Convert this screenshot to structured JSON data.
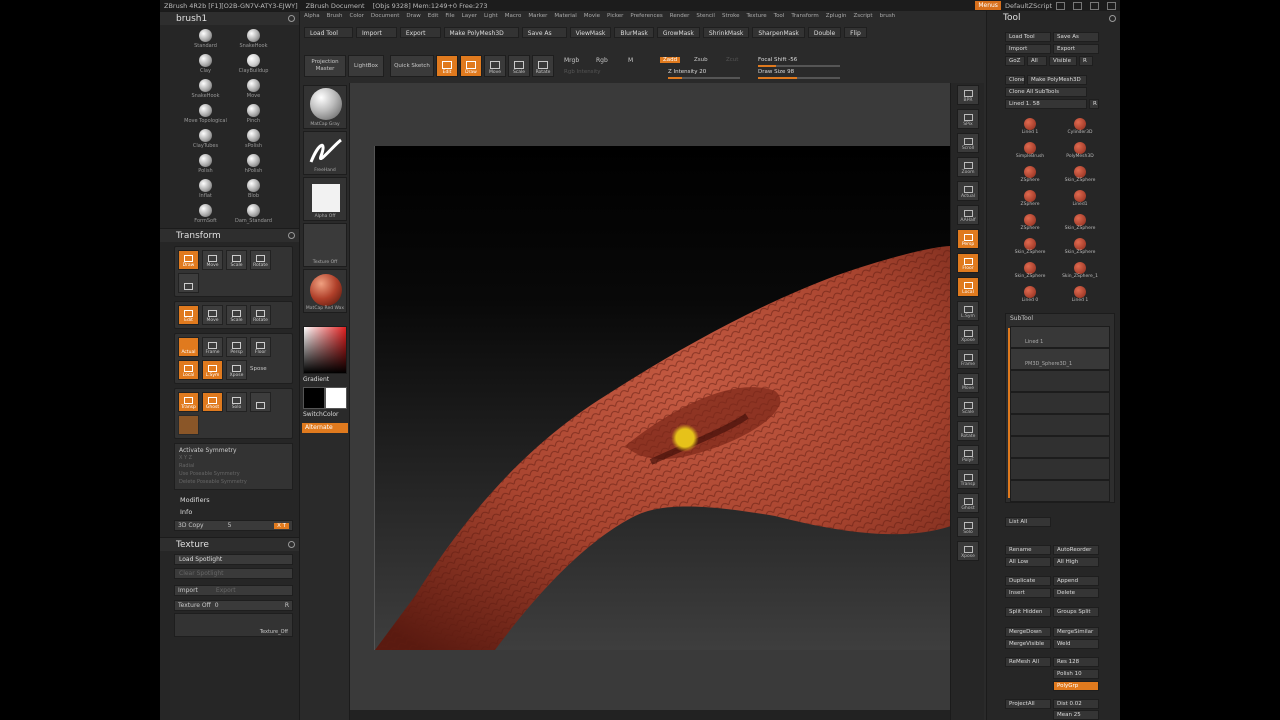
{
  "titlebar": {
    "app": "ZBrush 4R2b [F1][O2B-GN7V-ATY3-EJWY]",
    "doc": "ZBrush Document",
    "stats": "[Objs 9328] Mem:1249+0 Free:273",
    "menus_label": "Menus",
    "script": "DefaultZScript"
  },
  "menubar": [
    "Alpha",
    "Brush",
    "Color",
    "Document",
    "Draw",
    "Edit",
    "File",
    "Layer",
    "Light",
    "Macro",
    "Marker",
    "Material",
    "Movie",
    "Picker",
    "Preferences",
    "Render",
    "Stencil",
    "Stroke",
    "Texture",
    "Tool",
    "Transform",
    "Zplugin",
    "Zscript",
    "brush"
  ],
  "top_buttons": [
    "Load Tool",
    "Import",
    "Export",
    "Make PolyMesh3D",
    "Save As",
    "ViewMask",
    "BlurMask",
    "GrowMask",
    "ShrinkMask",
    "SharpenMask",
    "Double",
    "Flip"
  ],
  "projection": "Projection Master",
  "lightbox": "LightBox",
  "quick_sketch": "Quick Sketch",
  "tools": [
    {
      "label": "Edit",
      "on": true
    },
    {
      "label": "Draw",
      "on": true
    },
    {
      "label": "Move",
      "on": false
    },
    {
      "label": "Scale",
      "on": false
    },
    {
      "label": "Rotate",
      "on": false
    }
  ],
  "mrgb": {
    "mrgb": "Mrgb",
    "rgb": "Rgb",
    "m": "M",
    "intensity": "Rgb Intensity"
  },
  "zadd": {
    "zadd": "Zadd",
    "zsub": "Zsub",
    "zcut": "Zcut",
    "intensity": "Z Intensity 20",
    "intensity_value": 0.2
  },
  "focal": {
    "label": "Focal Shift -56",
    "value": 0.22
  },
  "drawsize": {
    "label": "Draw Size 98",
    "value": 0.48
  },
  "left": {
    "brush_title": "brush1",
    "brushes": [
      "Standard",
      "SnakeHook",
      "Clay",
      "ClayBuildup",
      "SnakeHook",
      "Move",
      "Move Topological",
      "Pinch",
      "ClayTubes",
      "sPolish",
      "Polish",
      "hPolish",
      "Inflat",
      "Blob",
      "FormSoft",
      "Dam_Standard"
    ],
    "transform_title": "Transform",
    "transform_top": [
      "Draw",
      "Move",
      "Scale",
      "Rotate"
    ],
    "transform_mid": [
      "Edit",
      "Move",
      "Scale",
      "Rotate"
    ],
    "transform_view": [
      "Frame",
      "Persp",
      "Floor",
      "Local",
      "L.Sym",
      "Xpose",
      "Transp",
      "Ghost",
      "Solo"
    ],
    "actual": "Actual",
    "spose": "Spose",
    "activate_symmetry": "Activate Symmetry",
    "sym_rows": [
      "X Y Z",
      "Radial",
      "Use Poseable Symmetry",
      "Delete Poseable Symmetry"
    ],
    "modifiers": "Modifiers",
    "info": "Info",
    "copy_label": "3D Copy",
    "copy_value": "5",
    "copy_btn": "X T",
    "texture_title": "Texture",
    "load_spotlight": "Load Spotlight",
    "clear_spotlight": "Clear Spotlight",
    "import": "Import",
    "export": "Export",
    "texture_off": "Texture Off",
    "texture_off_value": "0",
    "r": "R",
    "texture_footer": "Texture_Off"
  },
  "shelf": {
    "material": "MatCap Gray",
    "stroke": "FreeHand",
    "alpha": "Alpha Off",
    "texture": "Texture Off",
    "material2": "MatCap Red Wax",
    "gradient": "Gradient",
    "switchcolor": "SwitchColor",
    "alternate": "Alternate"
  },
  "rightshelf": [
    "BPR",
    "SPix",
    "Scroll",
    "Zoom",
    "Actual",
    "AAHalf",
    "Persp",
    "Floor",
    "Local",
    "L.Sym",
    "Xpose",
    "Frame",
    "Move",
    "Scale",
    "Rotate",
    "PolyF",
    "Transp",
    "Ghost",
    "Solo",
    "Xpose"
  ],
  "toolpanel": {
    "title": "Tool",
    "buttons": [
      [
        "Load Tool",
        "Save As"
      ],
      [
        "Import",
        "Export"
      ],
      [
        "GoZ",
        "All",
        "Visible",
        "R"
      ],
      [
        "Clone",
        "Make PolyMesh3D"
      ],
      [
        "Clone All SubTools"
      ]
    ],
    "lined": "Lined 1. 58",
    "thumbs": [
      "Lined 1",
      "Cylinder3D",
      "SimpleBrush",
      "PolyMesh3D",
      "ZSphere",
      "Skin_ZSphere",
      "ZSphere",
      "Lined1",
      "ZSphere",
      "Skin_ZSphere",
      "Skin_ZSphere",
      "Skin_ZSphere",
      "Skin_ZSphere",
      "Skin_ZSphere_1",
      "Lined 0",
      "Lined 1"
    ],
    "subtool_title": "SubTool",
    "subtools": [
      "Lined 1",
      "PM3D_Sphere3D_1",
      "",
      "",
      "",
      "",
      "",
      ""
    ],
    "list_all": "List All",
    "rename": "Rename",
    "autoreorder": "AutoReorder",
    "all_low": "All Low",
    "all_high": "All High",
    "duplicate": "Duplicate",
    "append": "Append",
    "insert": "Insert",
    "delete": "Delete",
    "split_hidden": "Split Hidden",
    "groups_split": "Groups Split",
    "merge_down": "MergeDown",
    "merge_similar": "MergeSimilar",
    "merge_visible": "MergeVisible",
    "weld": "Weld",
    "uv": "Uv",
    "remesh_all": "ReMesh All",
    "res": "Res 128",
    "polish": "Polish 10",
    "polygrp": "PolyGrp",
    "project_all": "ProjectAll",
    "dist": "Dist 0.02",
    "mean": "Mean 25"
  },
  "colors": {
    "accent": "#e07a1e",
    "panel": "#2a2a2a",
    "model": "#a8442f"
  }
}
